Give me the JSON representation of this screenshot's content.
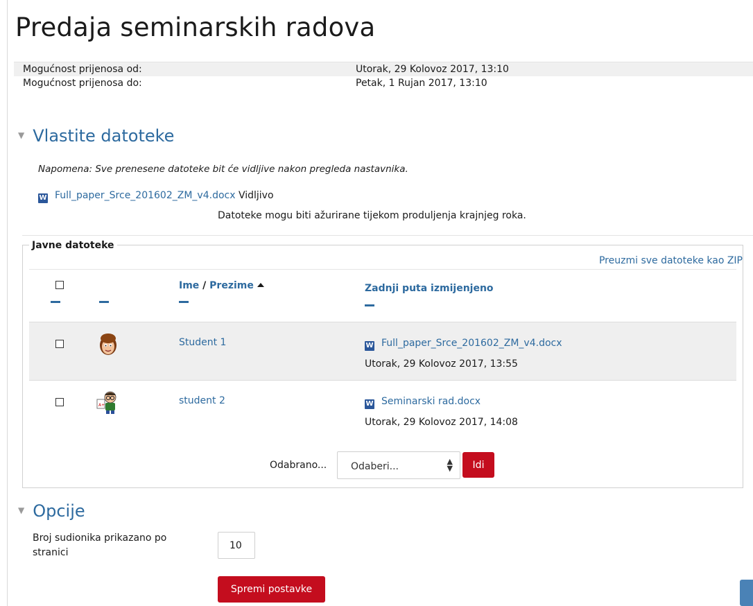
{
  "page": {
    "title": "Predaja seminarskih radova"
  },
  "dates": [
    {
      "label": "Mogućnost prijenosa od:",
      "value": "Utorak, 29 Kolovoz 2017, 13:10"
    },
    {
      "label": "Mogućnost prijenosa do:",
      "value": "Petak, 1 Rujan 2017, 13:10"
    }
  ],
  "own_files": {
    "heading": "Vlastite datoteke",
    "note": "Napomena: Sve prenesene datoteke bit će vidljive nakon pregleda nastavnika.",
    "file_name": "Full_paper_Srce_201602_ZM_v4.docx",
    "file_status": "Vidljivo",
    "extension_note": "Datoteke mogu biti ažurirane tijekom produljenja krajnjeg roka."
  },
  "public_files": {
    "legend": "Javne datoteke",
    "download_zip": "Preuzmi sve datoteke kao ZIP",
    "columns": {
      "first_name": "Ime",
      "separator": "/",
      "last_name": "Prezime",
      "modified": "Zadnji puta izmijenjeno"
    },
    "rows": [
      {
        "name": "Student 1",
        "file": "Full_paper_Srce_201602_ZM_v4.docx",
        "modified": "Utorak, 29 Kolovoz 2017, 13:55"
      },
      {
        "name": "student 2",
        "file": "Seminarski rad.docx",
        "modified": "Utorak, 29 Kolovoz 2017, 14:08"
      }
    ],
    "bulk": {
      "label": "Odabrano...",
      "select_value": "Odaberi...",
      "go_label": "Idi"
    }
  },
  "options": {
    "heading": "Opcije",
    "per_page_label": "Broj sudionika prikazano po stranici",
    "per_page_value": "10",
    "save_label": "Spremi postavke"
  },
  "icons": {
    "word": "word-document-icon",
    "collapse": "collapse-triangle-icon",
    "sort": "sort-ascending-icon"
  },
  "colors": {
    "link": "#2d6a9f",
    "button": "#c40d1e",
    "row_shade": "#efefef"
  }
}
